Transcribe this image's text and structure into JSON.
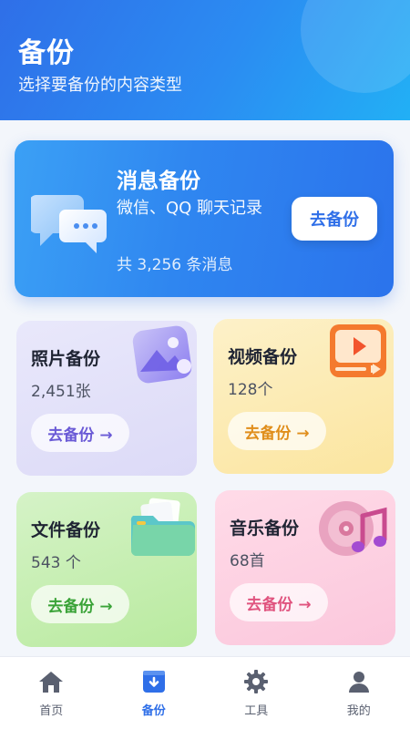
{
  "header": {
    "title": "备份",
    "subtitle": "选择要备份的内容类型"
  },
  "hero": {
    "title": "消息备份",
    "description": "微信、QQ 聊天记录",
    "count": "共 3,256 条消息",
    "button": "去备份",
    "icon": "chat-bubbles-icon"
  },
  "cards": [
    {
      "key": "photo",
      "title": "照片备份",
      "count": "2,451张",
      "button": "去备份 →",
      "icon": "photo-icon",
      "accent": "#6a5ad6"
    },
    {
      "key": "video",
      "title": "视频备份",
      "count": "128个",
      "button": "去备份 →",
      "icon": "video-player-icon",
      "accent": "#e08e1b"
    },
    {
      "key": "file",
      "title": "文件备份",
      "count": "543 个",
      "button": "去备份 →",
      "icon": "folder-icon",
      "accent": "#3aa338"
    },
    {
      "key": "music",
      "title": "音乐备份",
      "count": "68首",
      "button": "去备份 →",
      "icon": "music-disc-icon",
      "accent": "#e0547f"
    }
  ],
  "tabbar": {
    "items": [
      {
        "label": "首页",
        "icon": "home-icon",
        "active": false
      },
      {
        "label": "备份",
        "icon": "backup-icon",
        "active": true
      },
      {
        "label": "工具",
        "icon": "gear-icon",
        "active": false
      },
      {
        "label": "我的",
        "icon": "user-icon",
        "active": false
      }
    ]
  },
  "colors": {
    "primary": "#2f6fe8",
    "header_gradient_end": "#22b0f5",
    "tab_inactive": "#5a6070"
  }
}
